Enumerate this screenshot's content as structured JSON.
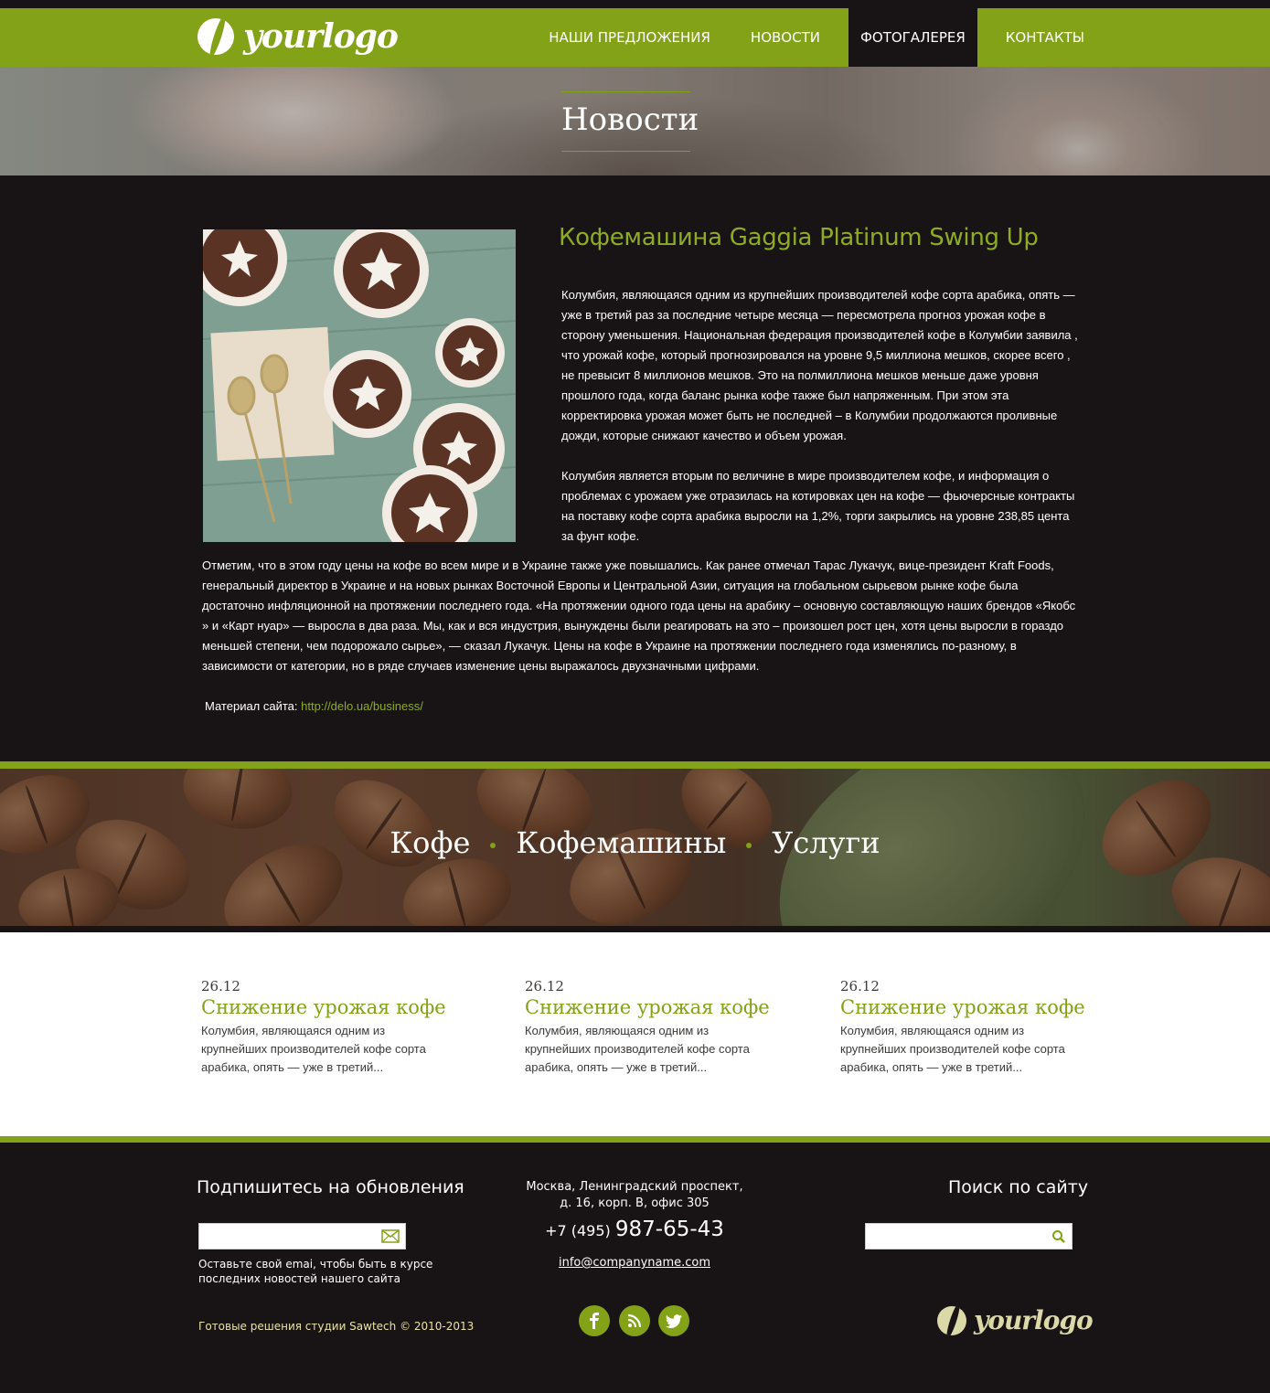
{
  "header": {
    "logo_text": "yourlogo",
    "nav": [
      {
        "label": "Наши предложения",
        "active": false
      },
      {
        "label": "Новости",
        "active": false
      },
      {
        "label": "Фотогалерея",
        "active": true
      },
      {
        "label": "Контакты",
        "active": false
      }
    ]
  },
  "hero": {
    "title": "Новости"
  },
  "article": {
    "title": "Кофемашина Gaggia Platinum Swing Up",
    "paragraphs": [
      "Колумбия, являющаяся одним из крупнейших производителей кофе сорта арабика, опять — уже в третий раз за последние четыре месяца — пересмотрела  прогноз урожая  кофе в сторону уменьшения. Национальная федерация производителей кофе в Колумбии  заявила , что урожай кофе,  который прогнозировался на уровне 9,5 миллиона мешков, скорее всего , не превысит 8 миллионов мешков. Это на полмиллиона мешков меньше даже уровня прошлого года, когда баланс рынка кофе также был напряженным.  При этом эта корректировка урожая может быть не последней – в Колумбии  продолжаются проливные дожди, которые снижают качество и объем урожая.",
      "Колумбия является вторым по величине в мире производителем кофе, и информация о проблемах с урожаем уже отразилась на котировках цен на кофе — фьючерсные контракты на поставку кофе сорта арабика выросли на 1,2%, торги закрылись на уровне 238,85 цента за фунт кофе.",
      "Отметим, что в этом году цены на кофе во всем мире и в Украине также уже повышались. Как ранее отмечал Тарас Лукачук, вице-президент Kraft Foods, генеральный директор в Украине и на новых рынках Восточной Европы и Центральной Азии, ситуация на глобальном сырьевом рынке кофе была достаточно инфляционной на протяжении последнего года. «На протяжении одного года цены на арабику – основную составляющую наших брендов «Якобс » и «Карт нуар» — выросла в два раза. Мы, как и вся индустрия, вынуждены были  реагировать на это – произошел рост цен, хотя цены выросли в гораздо меньшей степени, чем  подорожало сырье», — сказал Лукачук.  Цены на кофе в Украине на протяжении последнего года изменялись по-разному, в зависимости от категории, но в ряде случаев изменение цены выражалось двухзначными цифрами."
    ],
    "source_label": "Материал сайта:",
    "source_link": "http://delo.ua/business/"
  },
  "categories": [
    "Кофе",
    "Кофемашины",
    "Услуги"
  ],
  "news": [
    {
      "date": "26.12",
      "title": "Снижение урожая кофе",
      "excerpt": "Колумбия, являющаяся одним из крупнейших производителей кофе сорта арабика, опять — уже в третий..."
    },
    {
      "date": "26.12",
      "title": "Снижение урожая кофе",
      "excerpt": "Колумбия, являющаяся одним из крупнейших производителей кофе сорта арабика, опять — уже в третий..."
    },
    {
      "date": "26.12",
      "title": "Снижение урожая кофе",
      "excerpt": "Колумбия, являющаяся одним из крупнейших производителей кофе сорта арабика, опять — уже в третий..."
    }
  ],
  "footer": {
    "subscribe_heading": "Подпишитесь на обновления",
    "subscribe_note": "Оставьте свой emai, чтобы быть в курсе последних новостей нашего сайта",
    "copyright": "Готовые решения студии Sawtech © 2010-2013",
    "address_line1": "Москва, Ленинградский проспект,",
    "address_line2": "д. 16, корп. В, офис 305",
    "phone_code": "+7 (495)",
    "phone_number": "987-65-43",
    "email": "info@companyname.com",
    "search_heading": "Поиск по сайту",
    "logo_text": "yourlogo",
    "social": [
      "facebook-icon",
      "rss-icon",
      "twitter-icon"
    ]
  },
  "colors": {
    "accent": "#83a217",
    "dark": "#181314",
    "accent_text": "#8eab26"
  }
}
